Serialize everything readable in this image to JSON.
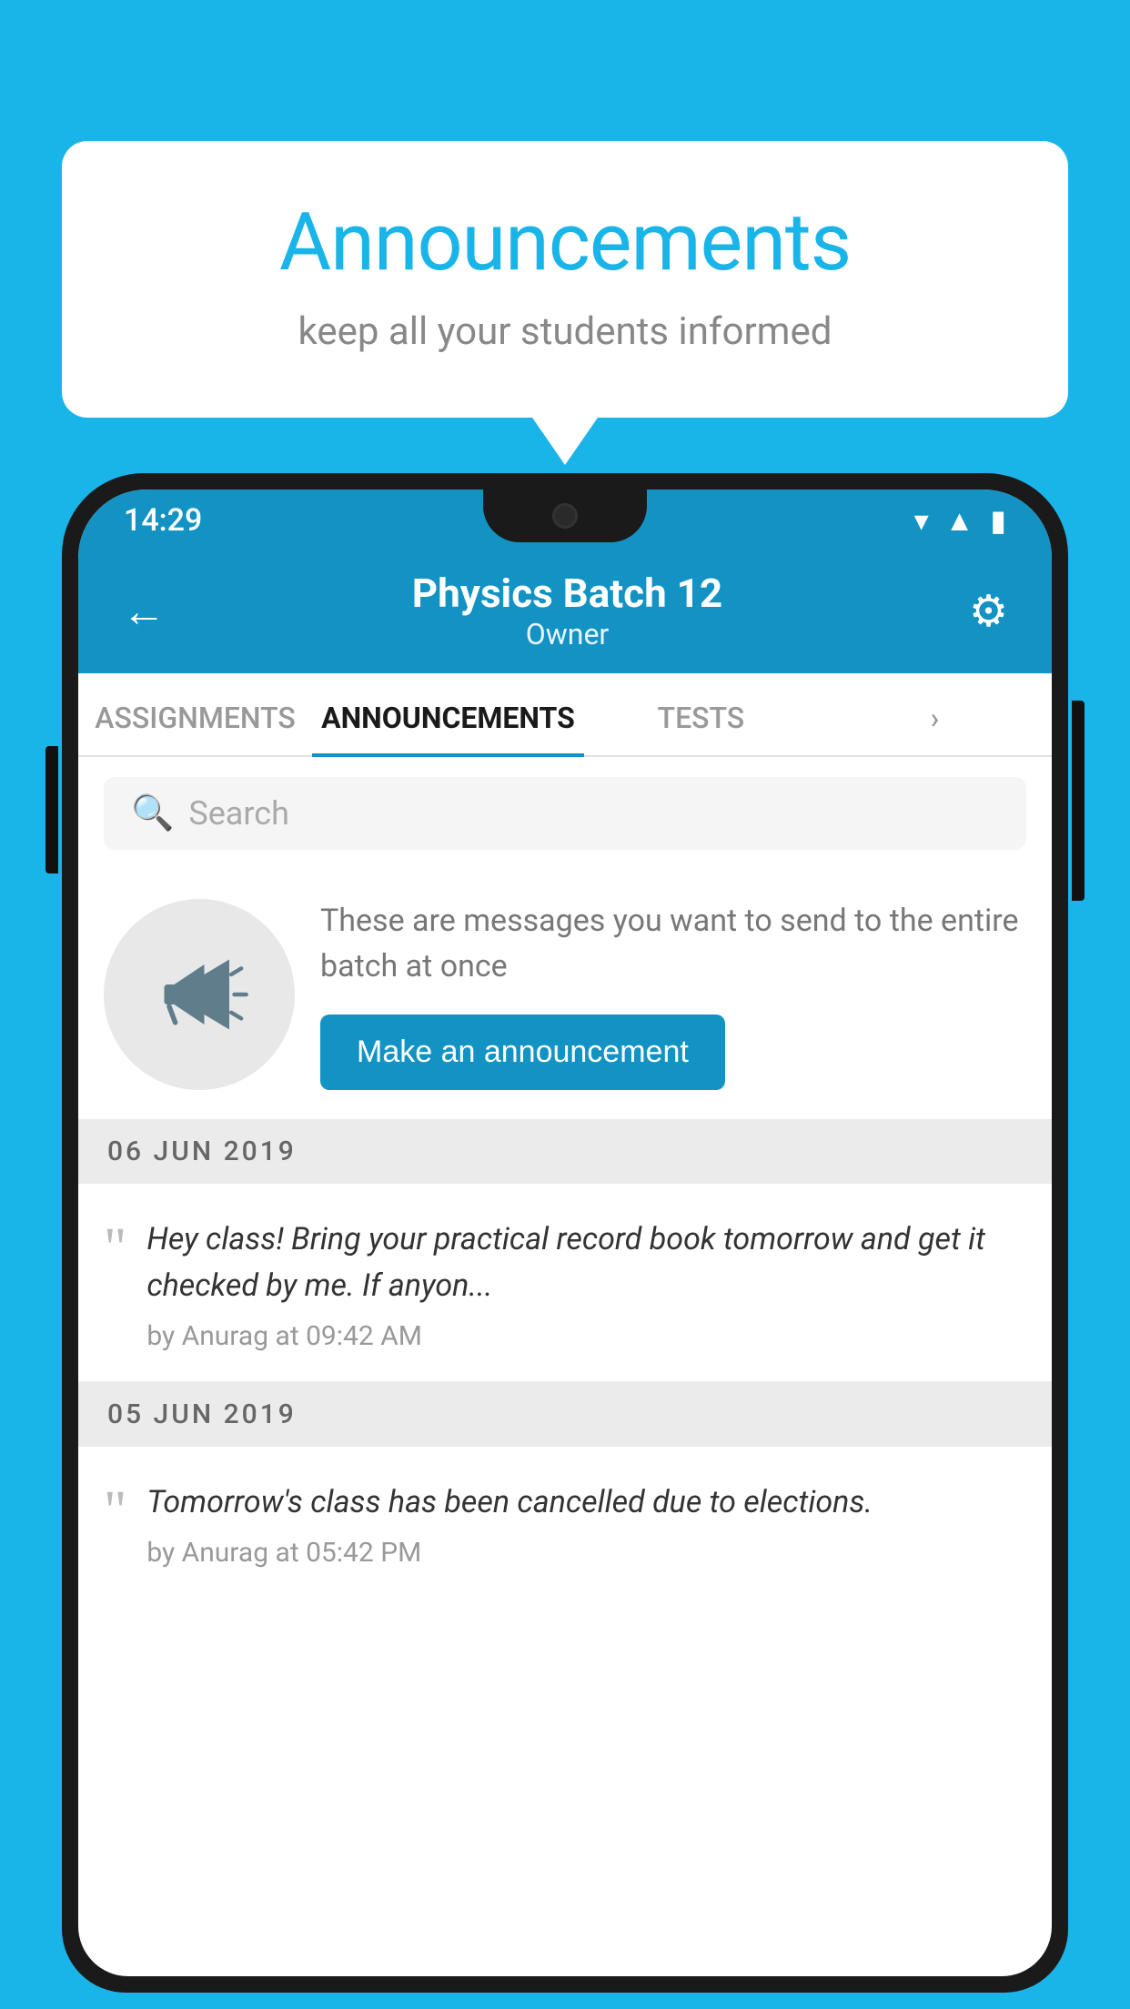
{
  "page": {
    "background_color": "#1ab5e8"
  },
  "speech_bubble": {
    "title": "Announcements",
    "subtitle": "keep all your students informed",
    "title_color": "#1ab5e8"
  },
  "phone": {
    "status_bar": {
      "time": "14:29",
      "wifi_icon": "▾",
      "signal_icon": "▲",
      "battery_icon": "▮"
    },
    "header": {
      "back_label": "←",
      "title": "Physics Batch 12",
      "subtitle": "Owner",
      "gear_label": "⚙"
    },
    "tabs": [
      {
        "label": "ASSIGNMENTS",
        "active": false
      },
      {
        "label": "ANNOUNCEMENTS",
        "active": true
      },
      {
        "label": "TESTS",
        "active": false
      },
      {
        "label": "",
        "active": false
      }
    ],
    "search": {
      "placeholder": "Search"
    },
    "promo": {
      "description": "These are messages you want to send to the entire batch at once",
      "button_label": "Make an announcement"
    },
    "announcements": [
      {
        "date": "06  JUN  2019",
        "text": "Hey class! Bring your practical record book tomorrow and get it checked by me. If anyon...",
        "meta": "by Anurag at 09:42 AM"
      },
      {
        "date": "05  JUN  2019",
        "text": "Tomorrow's class has been cancelled due to elections.",
        "meta": "by Anurag at 05:42 PM"
      }
    ]
  }
}
